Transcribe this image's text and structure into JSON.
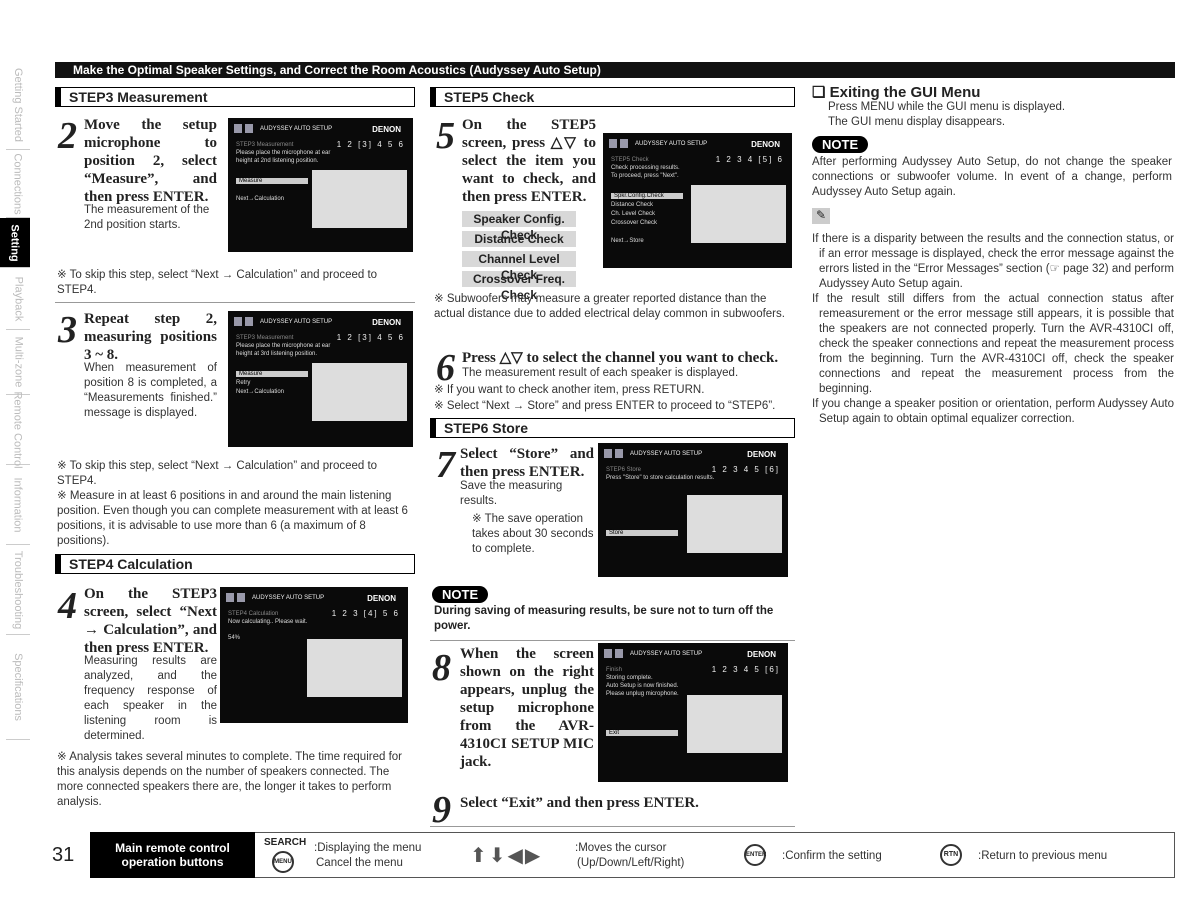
{
  "side_tabs": [
    "Getting Started",
    "Connections",
    "Setting",
    "Playback",
    "Multi-zone",
    "Remote Control",
    "Information",
    "Troubleshooting",
    "Specifications"
  ],
  "active_tab": "Setting",
  "header": "Make the Optimal Speaker Settings, and Correct the Room Acoustics (Audyssey Auto Setup)",
  "step3": {
    "title": "STEP3 Measurement",
    "s2_num": "2",
    "s2_head": "Move the setup microphone to position 2, select “Measure”, and then press ENTER.",
    "s2_body": "The measurement of the 2nd position starts.",
    "note1": "※ To skip this step, select “Next → Calculation” and proceed to STEP4.",
    "s3_num": "3",
    "s3_head": "Repeat step 2, measuring positions 3 ~ 8.",
    "s3_body": "When measurement of position 8 is completed, a “Measurements finished.” message is displayed.",
    "note2": "※ To skip this step, select “Next → Calculation” and proceed to STEP4.",
    "note3": "※ Measure in at least 6 positions in and around the main listening position. Even though you can complete measurement with at least 6 positions, it is advisable to use more than 6 (a maximum of 8 positions)."
  },
  "step4": {
    "title": "STEP4 Calculation",
    "num": "4",
    "head": "On the STEP3 screen, select “Next → Calculation”, and then press ENTER.",
    "body": "Measuring results are analyzed, and the frequency response of each speaker in the listening room is determined.",
    "note": "※ Analysis takes several minutes to complete. The time required for this analysis depends on the number of speakers connected. The more connected speakers there are, the longer it takes to perform analysis."
  },
  "step5": {
    "title": "STEP5 Check",
    "num": "5",
    "head": "On the STEP5 screen, press △▽ to select the item you want to check, and then press ENTER.",
    "items": [
      "Speaker Config. Check",
      "Distance Check",
      "Channel Level Check",
      "Crossover Freq. Check"
    ],
    "note": "※ Subwoofers may measure a greater reported distance than the actual distance due to added electrical delay common in subwoofers.",
    "s6_num": "6",
    "s6_head": "Press △▽ to select the channel you want to check.",
    "s6_body": "The measurement result of each speaker is displayed.",
    "s6_n1": "※ If you want to check another item, press RETURN.",
    "s6_n2": "※ Select “Next → Store” and press ENTER to proceed to “STEP6”."
  },
  "step6": {
    "title": "STEP6 Store",
    "num": "7",
    "head": "Select “Store” and then press ENTER.",
    "body": "Save the measuring results.",
    "note": "※ The save operation takes about 30 seconds to complete.",
    "note_badge": "NOTE",
    "warning": "During saving of measuring results, be sure not to turn off the power.",
    "s8_num": "8",
    "s8_head": "When the screen shown on the right appears, unplug the setup microphone from the AVR-4310CI SETUP MIC jack.",
    "s9_num": "9",
    "s9_head": "Select “Exit” and then press ENTER."
  },
  "right": {
    "title": "❏ Exiting the GUI Menu",
    "l1": "Press MENU while the GUI menu is displayed.",
    "l2": "The GUI menu display disappears.",
    "note_badge": "NOTE",
    "note": "After performing Audyssey Auto Setup, do not change the speaker connections or subwoofer volume. In event of a change, perform Audyssey Auto Setup again.",
    "bullets": [
      "If there is a disparity between the results and the connection status, or if an error message is displayed, check the error message against the errors listed in the “Error Messages” section (☞ page 32) and perform Audyssey Auto Setup again.",
      "If the result still differs from the actual connection status after remeasurement or the error message still appears, it is possible that the speakers are not connected properly. Turn the AVR-4310CI off, check the speaker connections and repeat the measurement process from the beginning. Turn the AVR-4310CI off, check the speaker connections and repeat the measurement process from the beginning.",
      "If you change a speaker position or orientation, perform Audyssey Auto Setup again to obtain optimal equalizer correction."
    ]
  },
  "screens": [
    {
      "sub": "STEP3 Measurement",
      "lines": [
        "Please place the microphone at ear",
        "height at 2nd listening position."
      ],
      "menu": [
        "Measure",
        "",
        "Next→Calculation"
      ],
      "steps": "1 2 [3] 4 5 6"
    },
    {
      "sub": "STEP3 Measurement",
      "lines": [
        "Please place the microphone at ear",
        "height at 3rd listening position."
      ],
      "menu": [
        "Measure",
        "Retry",
        "Next→Calculation"
      ],
      "steps": "1 2 [3] 4 5 6"
    },
    {
      "sub": "STEP4 Calculation",
      "lines": [
        "Now calculating.. Please wait.",
        "",
        "54%"
      ],
      "menu": [],
      "steps": "1 2 3 [4] 5 6"
    },
    {
      "sub": "STEP5 Check",
      "lines": [
        "Check processing results.",
        "To proceed, press \"Next\"."
      ],
      "menu": [
        "Spkr.Config.Check",
        "Distance Check",
        "Ch. Level Check",
        "Crossover Check",
        "",
        "Next→Store"
      ],
      "steps": "1 2 3 4 [5] 6"
    },
    {
      "sub": "STEP6 Store",
      "lines": [
        "Press \"Store\" to store calculation results."
      ],
      "menu": [
        "",
        "",
        "",
        "Store"
      ],
      "steps": "1 2 3 4 5 [6]"
    },
    {
      "sub": "Finish",
      "lines": [
        "Storing complete.",
        "Auto Setup is now finished.",
        "Please unplug microphone."
      ],
      "menu": [
        "",
        "",
        "",
        "Exit"
      ],
      "steps": "1 2 3 4 5 [6]"
    }
  ],
  "screen_title": "AUDYSSEY AUTO SETUP",
  "screen_brand": "DENON",
  "footer": {
    "page": "31",
    "box": "Main remote control operation buttons",
    "search": "SEARCH",
    "menu_btn": "MENU",
    "menu_desc1": ":Displaying the menu",
    "menu_desc2": "Cancel the menu",
    "cursor_desc1": ":Moves the cursor",
    "cursor_desc2": "(Up/Down/Left/Right)",
    "enter_btn": "ENTER",
    "enter_desc": ":Confirm the setting",
    "rtn_btn": "RTN",
    "rtn_desc": ":Return to previous menu"
  }
}
